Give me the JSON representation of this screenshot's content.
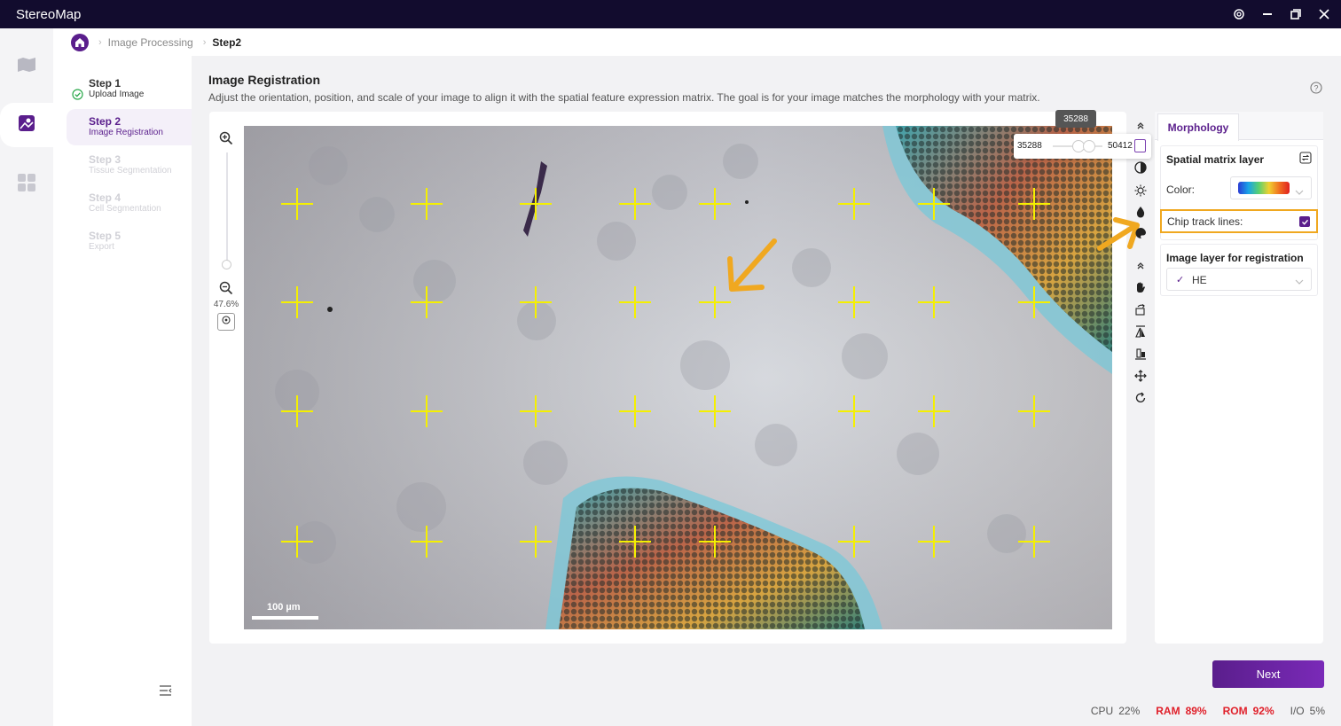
{
  "app": {
    "title": "StereoMap"
  },
  "breadcrumb": {
    "items": [
      "Image Processing",
      "Step2"
    ]
  },
  "steps": [
    {
      "title": "Step 1",
      "subtitle": "Upload Image",
      "state": "done"
    },
    {
      "title": "Step 2",
      "subtitle": "Image Registration",
      "state": "active"
    },
    {
      "title": "Step 3",
      "subtitle": "Tissue Segmentation",
      "state": "disabled"
    },
    {
      "title": "Step 4",
      "subtitle": "Cell Segmentation",
      "state": "disabled"
    },
    {
      "title": "Step 5",
      "subtitle": "Export",
      "state": "disabled"
    }
  ],
  "main": {
    "title": "Image Registration",
    "description": "Adjust the orientation, position, and scale of your image to align it with the spatial feature expression matrix. The goal is for your image matches the morphology with your matrix."
  },
  "canvas": {
    "zoom_level": "47.6%",
    "scale_bar": "100 µm",
    "slider": {
      "tooltip": "35288",
      "min": "35288",
      "max": "50412"
    }
  },
  "tools": [
    "collapse-up-icon",
    "contrast-icon",
    "brightness-icon",
    "color-drop-icon",
    "palette-icon",
    "collapse-up-icon",
    "hand-pan-icon",
    "rotate-icon",
    "flip-horizontal-icon",
    "flip-vertical-icon",
    "move-icon",
    "reset-icon"
  ],
  "right_panel": {
    "tab": "Morphology",
    "spatial_layer": {
      "title": "Spatial matrix layer",
      "color_label": "Color:",
      "chip_track_label": "Chip track lines:",
      "chip_track_checked": true
    },
    "image_layer": {
      "title": "Image layer for registration",
      "selected": "HE"
    }
  },
  "actions": {
    "next": "Next"
  },
  "status": {
    "cpu_label": "CPU",
    "cpu_value": "22%",
    "ram_label": "RAM",
    "ram_value": "89%",
    "rom_label": "ROM",
    "rom_value": "92%",
    "io_label": "I/O",
    "io_value": "5%"
  },
  "colors": {
    "brand": "#5a1e8c",
    "titlebar": "#120c2e",
    "highlight": "#f0a820",
    "crosshair": "#f5f000",
    "warn": "#e0202a"
  }
}
